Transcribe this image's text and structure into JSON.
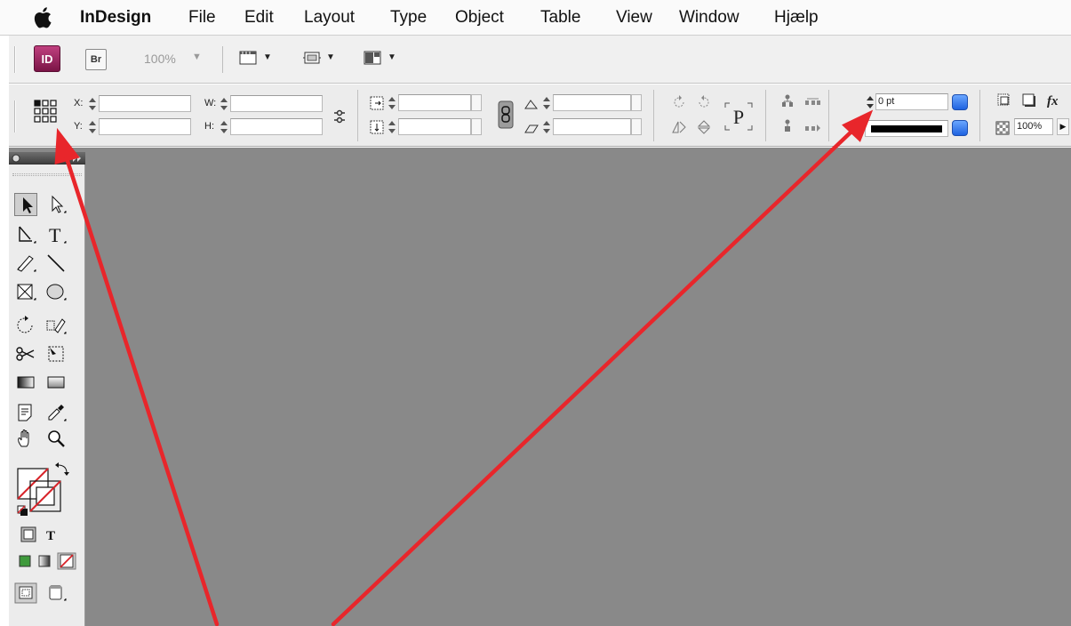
{
  "menubar": {
    "app_name": "InDesign",
    "items": [
      "File",
      "Edit",
      "Layout",
      "Type",
      "Object",
      "Table",
      "View",
      "Window",
      "Hjælp"
    ]
  },
  "appbar": {
    "id_label": "ID",
    "bridge_label": "Br",
    "zoom": "100%"
  },
  "control_panel": {
    "x_label": "X:",
    "y_label": "Y:",
    "w_label": "W:",
    "h_label": "H:",
    "stroke_weight": "0 pt",
    "opacity": "100%"
  },
  "colors": {
    "annotation_arrow": "#e8262b",
    "workspace": "#898989",
    "indesign_brand": "#9a1f5c"
  }
}
